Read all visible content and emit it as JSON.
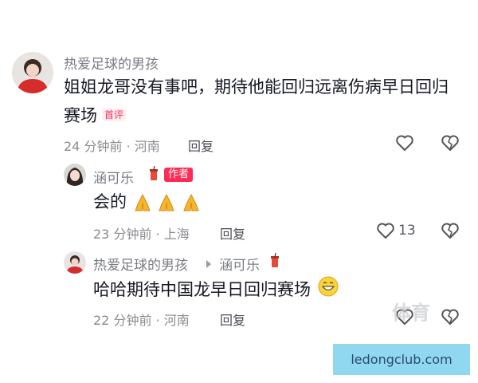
{
  "comments": [
    {
      "username": "热爱足球的男孩",
      "line1": "姐姐龙哥没有事吧，期待他能回归远离伤病早日回归",
      "line2": "赛场",
      "badge": "首评",
      "time_location": "24 分钟前 · 河南",
      "reply_label": "回复"
    },
    {
      "username": "涵可乐",
      "author_badge": "作者",
      "text": "会的",
      "time_location": "23 分钟前 · 上海",
      "reply_label": "回复",
      "like_count": "13"
    },
    {
      "username": "热爱足球的男孩",
      "reply_to": "涵可乐",
      "text": "哈哈期待中国龙早日回归赛场",
      "time_location": "22 分钟前 · 河南",
      "reply_label": "回复"
    }
  ],
  "watermark": "体育",
  "domain_label": "ledongclub.com",
  "colors": {
    "accent": "#fe2c55",
    "domain_bg": "#8fd8f0"
  }
}
